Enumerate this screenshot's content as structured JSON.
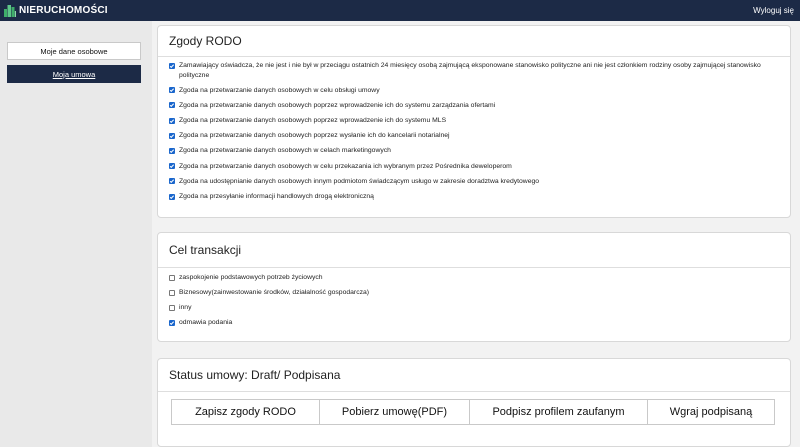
{
  "header": {
    "brand": "NIERUCHOMOŚCI",
    "logout": "Wyloguj się"
  },
  "sidebar": {
    "items": [
      {
        "label": "Moje dane osobowe",
        "active": false
      },
      {
        "label": "Moja umowa",
        "active": true
      }
    ]
  },
  "rodo": {
    "title": "Zgody RODO",
    "items": [
      {
        "label": "Zamawiający oświadcza, że nie jest i nie był w przeciągu ostatnich 24 miesięcy osobą zajmującą eksponowane stanowisko polityczne ani nie jest członkiem rodziny osoby zajmującej stanowisko polityczne",
        "checked": true
      },
      {
        "label": "Zgoda na przetwarzanie danych osobowych w celu obsługi umowy",
        "checked": true
      },
      {
        "label": "Zgoda na przetwarzanie danych osobowych poprzez wprowadzenie ich do systemu zarządzania ofertami",
        "checked": true
      },
      {
        "label": "Zgoda na przetwarzanie danych osobowych poprzez wprowadzenie ich do systemu MLS",
        "checked": true
      },
      {
        "label": "Zgoda na przetwarzanie danych osobowych poprzez wysłanie ich do kancelarii notarialnej",
        "checked": true
      },
      {
        "label": "Zgoda na przetwarzanie danych osobowych w celach marketingowych",
        "checked": true
      },
      {
        "label": "Zgoda na przetwarzanie danych osobowych w celu przekazania ich wybranym przez Pośrednika deweloperom",
        "checked": true
      },
      {
        "label": "Zgoda na udostępnianie danych osobowych innym podmiotom świadczącym usługo w zakresie doradztwa kredytowego",
        "checked": true
      },
      {
        "label": "Zgoda na przesyłanie informacji handlowych drogą elektroniczną",
        "checked": true
      }
    ]
  },
  "transaction": {
    "title": "Cel transakcji",
    "options": [
      {
        "label": "zaspokojenie podstawowych potrzeb życiowych",
        "checked": false
      },
      {
        "label": "Biznesowy(zainwestowanie środków, działalność gospodarcza)",
        "checked": false
      },
      {
        "label": "inny",
        "checked": false
      },
      {
        "label": "odmawia podania",
        "checked": true
      }
    ]
  },
  "status": {
    "title": "Status umowy: Draft/ Podpisana",
    "buttons": {
      "save": "Zapisz zgody RODO",
      "download": "Pobierz umowę(PDF)",
      "sign": "Podpisz profilem zaufanym",
      "upload": "Wgraj podpisaną"
    }
  },
  "colors": {
    "header_bg": "#1c2a46",
    "checkbox_accent": "#1a66cc",
    "page_bg": "#f2f2f2"
  }
}
